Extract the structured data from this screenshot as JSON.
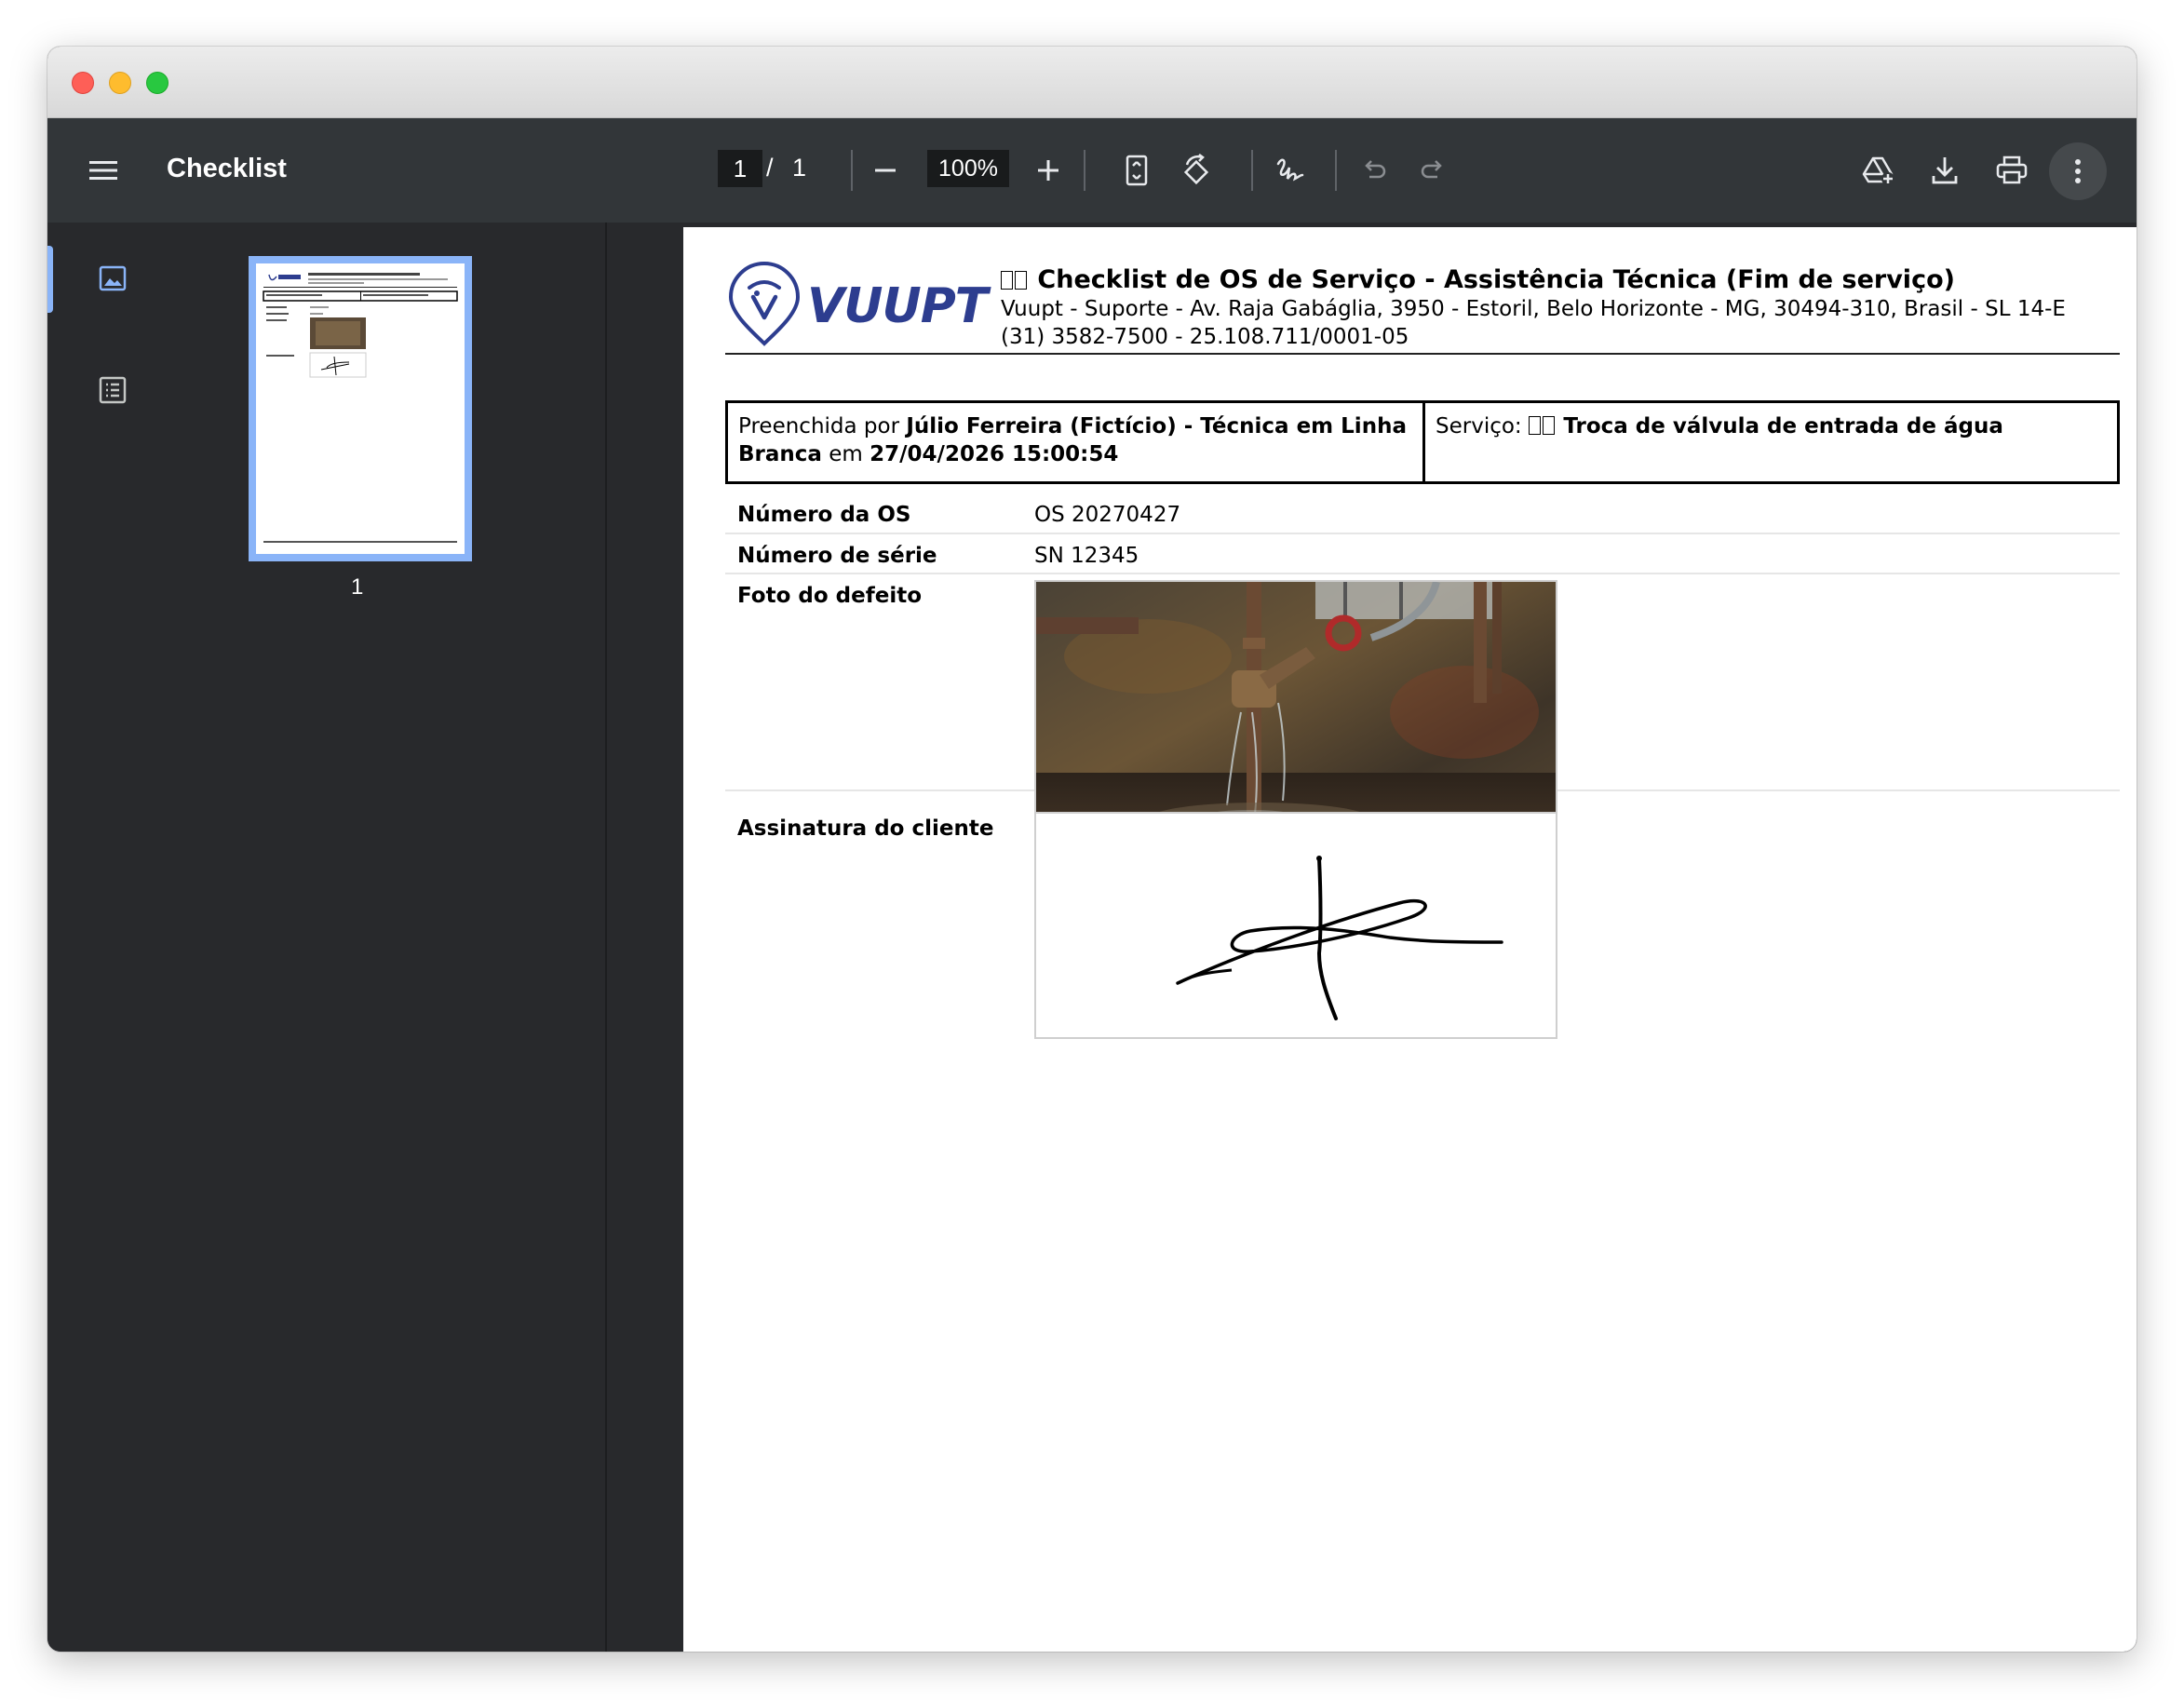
{
  "window": {
    "controls": [
      "close",
      "minimize",
      "maximize"
    ]
  },
  "toolbar": {
    "menu_icon": "hamburger-menu-icon",
    "title": "Checklist",
    "page_current": "1",
    "page_separator": "/",
    "page_total": "1",
    "zoom": "100%",
    "icons": [
      "zoom-out-icon",
      "zoom-in-icon",
      "fit-page-icon",
      "rotate-icon",
      "annotate-icon",
      "undo-icon",
      "redo-icon",
      "save-to-drive-icon",
      "download-icon",
      "print-icon",
      "more-options-icon"
    ]
  },
  "sidebar": {
    "tabs": [
      "thumbnails-icon",
      "outline-icon"
    ],
    "thumbnail_label": "1"
  },
  "document": {
    "logo_text": "VUUPT",
    "title": "Checklist de OS de Serviço - Assistência Técnica (Fim de serviço)",
    "address": "Vuupt - Suporte - Av. Raja Gabáglia, 3950 - Estoril, Belo Horizonte - MG, 30494-310, Brasil - SL 14-E",
    "contact": "(31) 3582-7500 - 25.108.711/0001-05",
    "filled_by_prefix": "Preenchida por",
    "filled_by_name": "Júlio Ferreira (Fictício) - Técnica em Linha Branca",
    "filled_on_prefix": "em",
    "filled_on": "27/04/2026 15:00:54",
    "service_prefix": "Serviço:",
    "service_name": "Troca de válvula de entrada de água",
    "rows": [
      {
        "label": "Número da OS",
        "value": "OS 20270427"
      },
      {
        "label": "Número de série",
        "value": "SN 12345"
      },
      {
        "label": "Foto do defeito",
        "value": ""
      },
      {
        "label": "Assinatura do cliente",
        "value": ""
      }
    ]
  },
  "colors": {
    "toolbar_bg": "#323639",
    "sidebar_bg": "#28292c",
    "accent": "#8ab4f8",
    "logo": "#2d3d8f"
  }
}
